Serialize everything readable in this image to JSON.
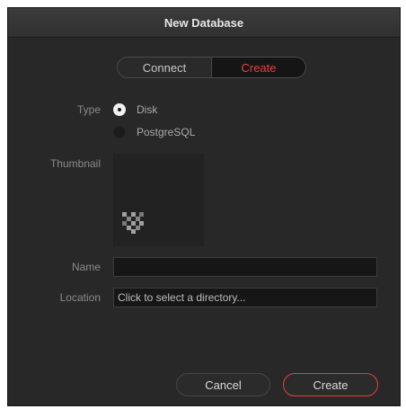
{
  "dialog": {
    "title": "New Database"
  },
  "mode_toggle": {
    "connect_label": "Connect",
    "create_label": "Create",
    "selected": "Create",
    "active_color": "#e8413d"
  },
  "type": {
    "label": "Type",
    "options": [
      {
        "label": "Disk",
        "selected": true
      },
      {
        "label": "PostgreSQL",
        "selected": false
      }
    ]
  },
  "thumbnail": {
    "label": "Thumbnail",
    "icon": "database-thumbnail-icon"
  },
  "name": {
    "label": "Name",
    "value": ""
  },
  "location": {
    "label": "Location",
    "placeholder": "Click to select a directory..."
  },
  "buttons": {
    "cancel_label": "Cancel",
    "create_label": "Create",
    "create_border_color": "#e0423c"
  }
}
